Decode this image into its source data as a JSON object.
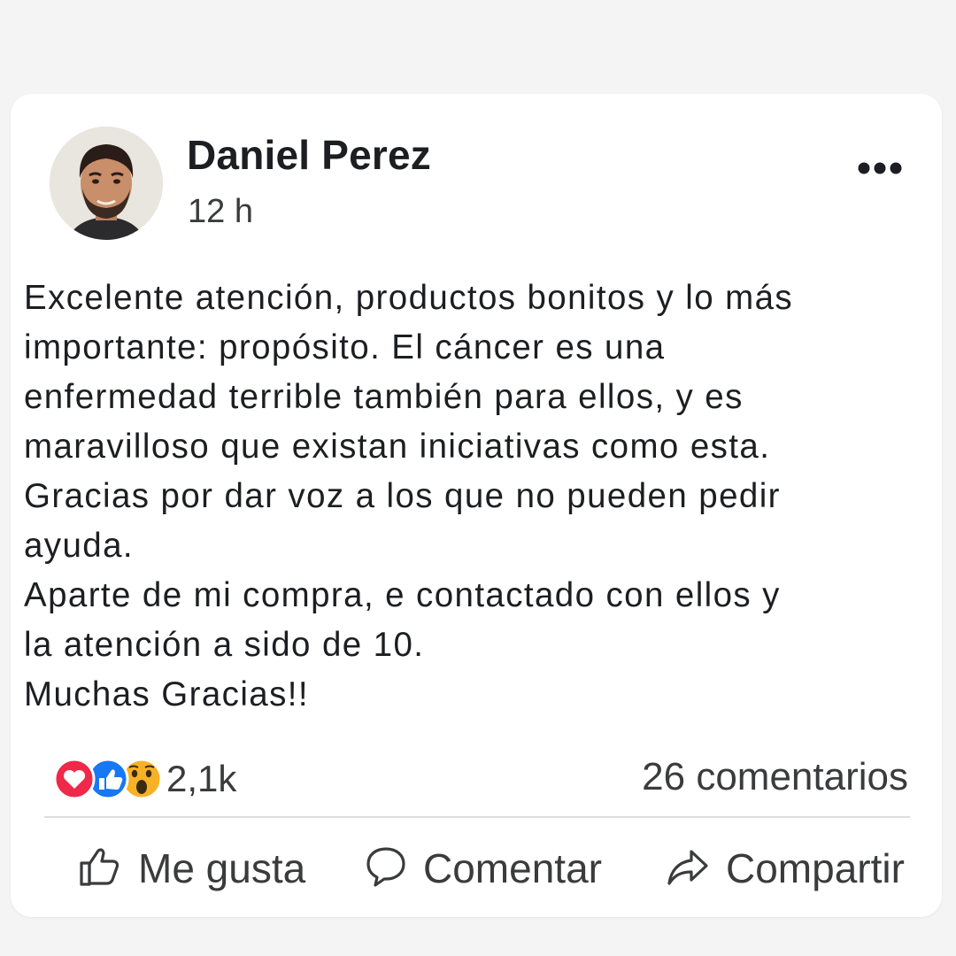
{
  "post": {
    "author": "Daniel Perez",
    "time": "12 h",
    "avatar_icon": "profile-photo-man-with-beard",
    "more_icon": "more-options-ellipsis-icon",
    "body_lines": [
      "Excelente atención, productos bonitos y lo más",
      "importante: propósito. El cáncer es una",
      "enfermedad terrible también para ellos, y es",
      "maravilloso que existan iniciativas como esta.",
      "Gracias por dar voz a los que no pueden pedir",
      "ayuda.",
      "Aparte de mi compra, e contactado con ellos y",
      "la atención a sido de 10.",
      "Muchas Gracias!!"
    ]
  },
  "stats": {
    "reaction_icons": [
      "love-reaction-icon",
      "like-reaction-icon",
      "wow-reaction-icon"
    ],
    "reactions_count": "2,1k",
    "comments": "26 comentarios"
  },
  "actions": {
    "like": "Me gusta",
    "comment": "Comentar",
    "share": "Compartir"
  },
  "colors": {
    "love": "#f02849",
    "like": "#1877f2",
    "wow": "#f7b125",
    "text": "#1c1e21",
    "secondary_text": "#3a3b3c"
  }
}
